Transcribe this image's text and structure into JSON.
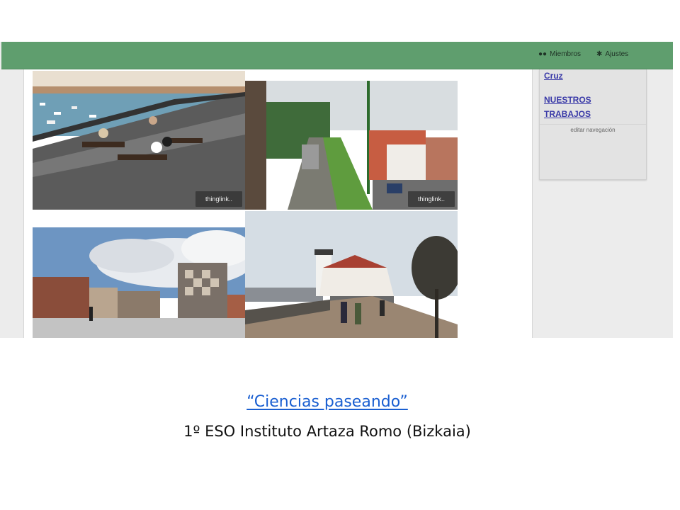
{
  "topbar": {
    "members_label": "Miembros",
    "members_icon": "users-icon",
    "settings_label": "Ajustes",
    "settings_icon": "gear-icon"
  },
  "sidebar": {
    "items": [
      {
        "label": "Cruz"
      },
      {
        "label": "NUESTROS"
      },
      {
        "label": "TRABAJOS"
      }
    ],
    "edit_label": "editar navegación"
  },
  "photos": {
    "badge_label": "thinglink.."
  },
  "caption": {
    "title": "“Ciencias paseando”",
    "subtitle": "1º ESO Instituto Artaza Romo (Bizkaia)"
  },
  "colors": {
    "topbar": "#5f9e6e",
    "link": "#1a5fd1",
    "nav_link": "#3a3aa8"
  }
}
